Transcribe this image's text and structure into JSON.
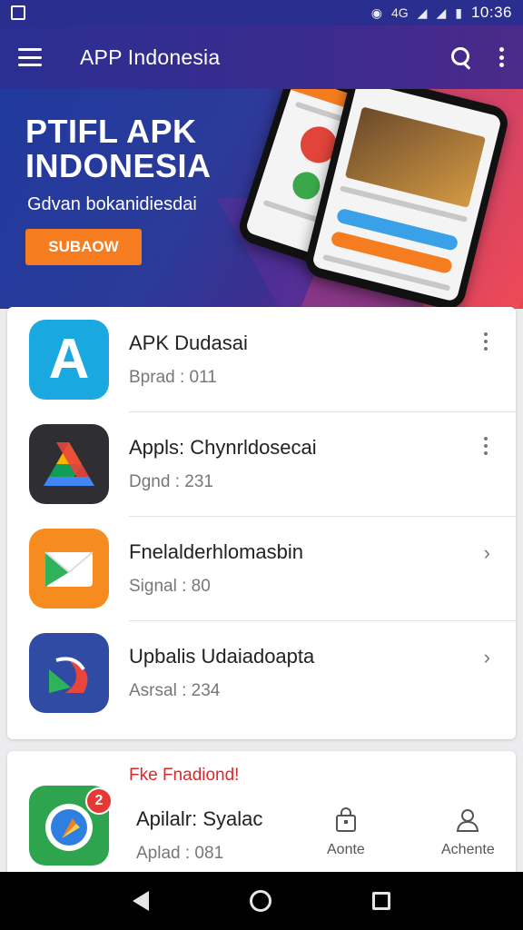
{
  "status_bar": {
    "network": "4G",
    "time": "10:36"
  },
  "appbar": {
    "title": "APP Indonesia"
  },
  "banner": {
    "headline_line1": "PTIFL APK",
    "headline_line2": "INDONESIA",
    "subtitle": "Gdvan bokanidiesdai",
    "cta": "SUBAOW"
  },
  "apps": [
    {
      "name": "APK Dudasai",
      "meta": "Bprad : 011",
      "icon": "letter-a-icon"
    },
    {
      "name": "Appls: Chynrldosecai",
      "meta": "Dgnd : 231",
      "icon": "drive-triangle-icon"
    },
    {
      "name": "Fnelalderhlomasbin",
      "meta": "Signal : 80",
      "icon": "mail-envelope-icon"
    },
    {
      "name": "Upbalis Udaiadoapta",
      "meta": "Asrsal : 234",
      "icon": "swirl-icon"
    }
  ],
  "promo": {
    "label": "Fke Fnadiond!",
    "badge": "2",
    "name": "Apilalr: Syalac",
    "meta": "Aplad : 081",
    "nav_home": "Aonte",
    "nav_account": "Achente"
  },
  "colors": {
    "appbar": "#2b2f92",
    "accent_orange": "#f57c1f",
    "promo_label": "#d62b2b"
  }
}
